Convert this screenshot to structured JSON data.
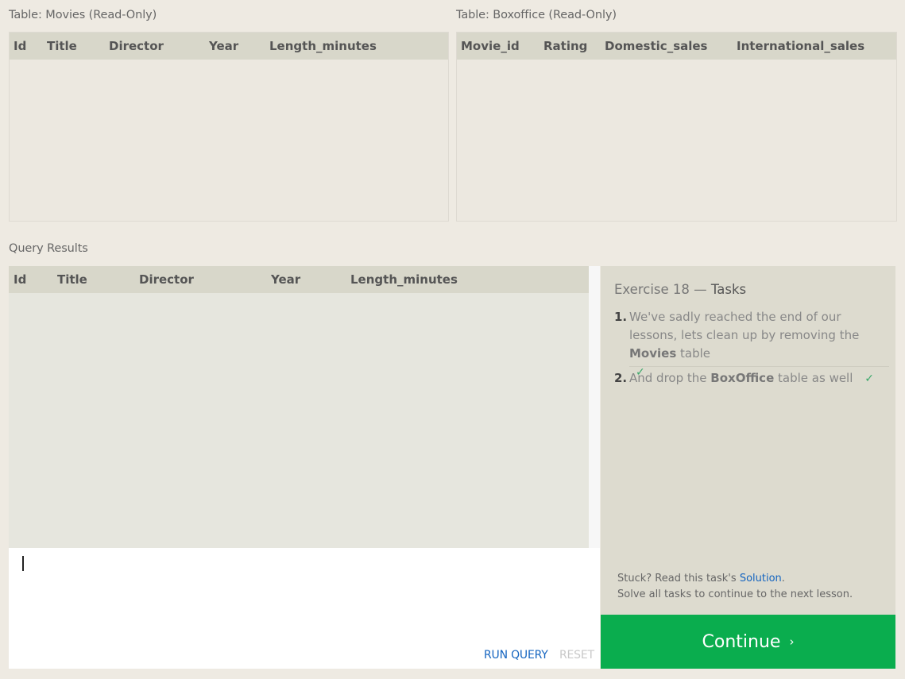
{
  "movies_table": {
    "title": "Table: Movies (Read-Only)",
    "columns": [
      "Id",
      "Title",
      "Director",
      "Year",
      "Length_minutes"
    ],
    "rows": []
  },
  "boxoffice_table": {
    "title": "Table: Boxoffice (Read-Only)",
    "columns": [
      "Movie_id",
      "Rating",
      "Domestic_sales",
      "International_sales"
    ],
    "rows": []
  },
  "results": {
    "title": "Query Results",
    "columns": [
      "Id",
      "Title",
      "Director",
      "Year",
      "Length_minutes"
    ],
    "rows": []
  },
  "editor": {
    "value": "",
    "run_label": "RUN QUERY",
    "reset_label": "RESET"
  },
  "tasks": {
    "exercise_label": "Exercise 18 —",
    "title": "Tasks",
    "items": [
      {
        "number": "1.",
        "text_before": "We've sadly reached the end of our lessons, lets clean up by removing the",
        "bold": "Movies",
        "text_after": "table",
        "check": "✓",
        "completed": true
      },
      {
        "number": "2.",
        "text_before": "And drop the",
        "bold": "BoxOffice",
        "text_after": "table as well",
        "check": "✓",
        "completed": true
      }
    ],
    "stuck_prefix": "Stuck? Read this task's",
    "solution_link": "Solution",
    "stuck_suffix": ".",
    "solve_all_text": "Solve all tasks to continue to the next lesson."
  },
  "continue_button": {
    "label": "Continue",
    "chevron": "›"
  },
  "colors": {
    "page_bg": "#eeeae2",
    "header_bg": "#d8d7ca",
    "tasks_bg": "#dddbcf",
    "continue_bg": "#0aad4e",
    "link": "#1565c0",
    "check": "#3aa86a"
  }
}
